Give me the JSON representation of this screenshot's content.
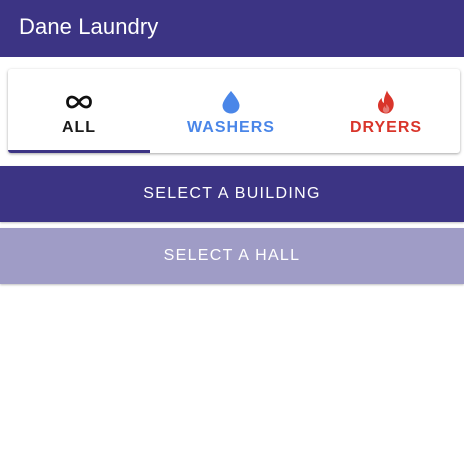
{
  "appbar": {
    "title": "Dane Laundry",
    "color": "#3c3484"
  },
  "tabs": [
    {
      "label": "ALL",
      "icon": "infinity-icon",
      "color": "#1a1a1a",
      "selected": true
    },
    {
      "label": "WASHERS",
      "icon": "water-drop-icon",
      "color": "#4a86e8",
      "selected": false
    },
    {
      "label": "DRYERS",
      "icon": "fire-icon",
      "color": "#d9352b",
      "selected": false
    }
  ],
  "actions": {
    "select_building": "SELECT A BUILDING",
    "select_hall": "SELECT A HALL",
    "building_color": "#3c3484",
    "hall_color": "#9f9cc6"
  }
}
